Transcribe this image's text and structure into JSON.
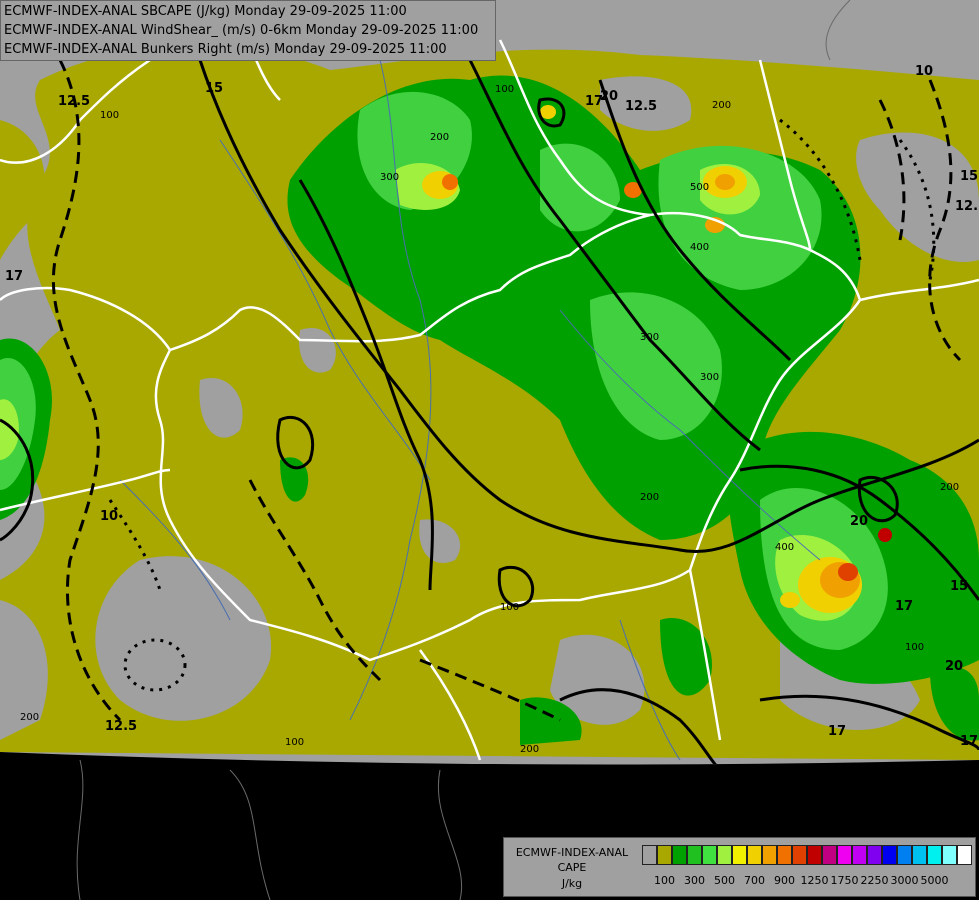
{
  "header": {
    "line1": "ECMWF-INDEX-ANAL SBCAPE (J/kg) Monday 29-09-2025 11:00",
    "line2": "ECMWF-INDEX-ANAL WindShear_ (m/s) 0-6km Monday 29-09-2025 11:00",
    "line3": "ECMWF-INDEX-ANAL Bunkers Right (m/s) Monday 29-09-2025 11:00"
  },
  "legend": {
    "title1": "ECMWF-INDEX-ANAL",
    "title2": "CAPE",
    "title3": "J/kg",
    "colors": [
      "#a0a0a0",
      "#a8a800",
      "#00a000",
      "#20c020",
      "#40e040",
      "#a0f040",
      "#f0f000",
      "#f0d000",
      "#f0a000",
      "#f07000",
      "#e04000",
      "#c00000",
      "#c00080",
      "#f000f0",
      "#c000f0",
      "#8000f0",
      "#0000f0",
      "#0080f0",
      "#00c0f0",
      "#00f0f0",
      "#80ffff",
      "#ffffff"
    ],
    "ticks": [
      {
        "label": "100",
        "i": 1
      },
      {
        "label": "300",
        "i": 3
      },
      {
        "label": "500",
        "i": 5
      },
      {
        "label": "700",
        "i": 7
      },
      {
        "label": "900",
        "i": 9
      },
      {
        "label": "1250",
        "i": 11
      },
      {
        "label": "1750",
        "i": 13
      },
      {
        "label": "2250",
        "i": 15
      },
      {
        "label": "3000",
        "i": 17
      },
      {
        "label": "5000",
        "i": 19
      }
    ]
  },
  "map": {
    "shear_labels": [
      "12.5",
      "15",
      "17",
      "20",
      "10",
      "12.5",
      "17",
      "15",
      "12.5",
      "10",
      "17",
      "20",
      "20",
      "17",
      "12.5",
      "15",
      "17"
    ],
    "cape_labels": [
      "100",
      "200",
      "300",
      "400",
      "500",
      "100",
      "200",
      "300",
      "200",
      "100",
      "200",
      "100",
      "200",
      "100",
      "200",
      "300",
      "400"
    ]
  }
}
